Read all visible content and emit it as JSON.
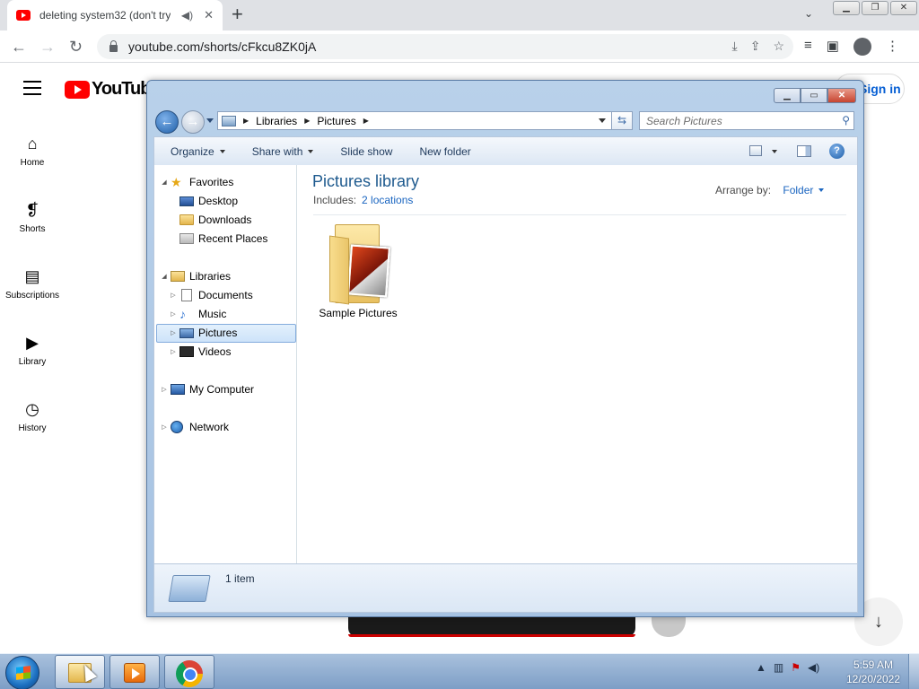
{
  "browser": {
    "tab_title": "deleting system32 (don't try",
    "tab_audio_icon": "speaker-icon",
    "tab_close": "✕",
    "new_tab": "+",
    "tab_search": "⌄",
    "url": "youtube.com/shorts/cFkcu8ZK0jA",
    "window_buttons": [
      "▁",
      "❐",
      "✕"
    ]
  },
  "youtube": {
    "logo_text": "YouTube",
    "sign_in": "Sign in",
    "nav": [
      {
        "label": "Home",
        "icon": "home-icon"
      },
      {
        "label": "Shorts",
        "icon": "shorts-icon"
      },
      {
        "label": "Subscriptions",
        "icon": "subscriptions-icon"
      },
      {
        "label": "Library",
        "icon": "library-icon"
      },
      {
        "label": "History",
        "icon": "history-icon"
      }
    ]
  },
  "explorer": {
    "breadcrumb": [
      "Libraries",
      "Pictures"
    ],
    "search_placeholder": "Search Pictures",
    "commands": [
      "Organize",
      "Share with",
      "Slide show",
      "New folder"
    ],
    "tree": {
      "favorites": "Favorites",
      "desktop": "Desktop",
      "downloads": "Downloads",
      "recent": "Recent Places",
      "libraries": "Libraries",
      "documents": "Documents",
      "music": "Music",
      "pictures": "Pictures",
      "videos": "Videos",
      "computer": "My Computer",
      "network": "Network"
    },
    "library_title": "Pictures library",
    "includes_label": "Includes:",
    "includes_link": "2 locations",
    "arrange_label": "Arrange by:",
    "arrange_value": "Folder",
    "items": [
      {
        "label": "Sample Pictures"
      }
    ],
    "status": "1 item"
  },
  "taskbar": {
    "time": "5:59 AM",
    "date": "12/20/2022"
  }
}
